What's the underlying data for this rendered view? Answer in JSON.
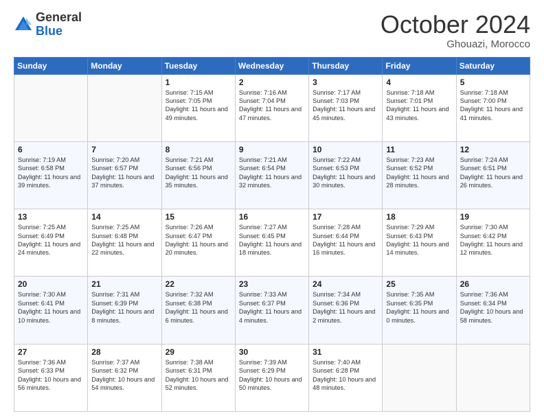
{
  "header": {
    "logo": {
      "general": "General",
      "blue": "Blue"
    },
    "title": "October 2024",
    "location": "Ghouazi, Morocco"
  },
  "days_of_week": [
    "Sunday",
    "Monday",
    "Tuesday",
    "Wednesday",
    "Thursday",
    "Friday",
    "Saturday"
  ],
  "weeks": [
    [
      {
        "day": "",
        "text": ""
      },
      {
        "day": "",
        "text": ""
      },
      {
        "day": "1",
        "text": "Sunrise: 7:15 AM\nSunset: 7:05 PM\nDaylight: 11 hours and 49 minutes."
      },
      {
        "day": "2",
        "text": "Sunrise: 7:16 AM\nSunset: 7:04 PM\nDaylight: 11 hours and 47 minutes."
      },
      {
        "day": "3",
        "text": "Sunrise: 7:17 AM\nSunset: 7:03 PM\nDaylight: 11 hours and 45 minutes."
      },
      {
        "day": "4",
        "text": "Sunrise: 7:18 AM\nSunset: 7:01 PM\nDaylight: 11 hours and 43 minutes."
      },
      {
        "day": "5",
        "text": "Sunrise: 7:18 AM\nSunset: 7:00 PM\nDaylight: 11 hours and 41 minutes."
      }
    ],
    [
      {
        "day": "6",
        "text": "Sunrise: 7:19 AM\nSunset: 6:58 PM\nDaylight: 11 hours and 39 minutes."
      },
      {
        "day": "7",
        "text": "Sunrise: 7:20 AM\nSunset: 6:57 PM\nDaylight: 11 hours and 37 minutes."
      },
      {
        "day": "8",
        "text": "Sunrise: 7:21 AM\nSunset: 6:56 PM\nDaylight: 11 hours and 35 minutes."
      },
      {
        "day": "9",
        "text": "Sunrise: 7:21 AM\nSunset: 6:54 PM\nDaylight: 11 hours and 32 minutes."
      },
      {
        "day": "10",
        "text": "Sunrise: 7:22 AM\nSunset: 6:53 PM\nDaylight: 11 hours and 30 minutes."
      },
      {
        "day": "11",
        "text": "Sunrise: 7:23 AM\nSunset: 6:52 PM\nDaylight: 11 hours and 28 minutes."
      },
      {
        "day": "12",
        "text": "Sunrise: 7:24 AM\nSunset: 6:51 PM\nDaylight: 11 hours and 26 minutes."
      }
    ],
    [
      {
        "day": "13",
        "text": "Sunrise: 7:25 AM\nSunset: 6:49 PM\nDaylight: 11 hours and 24 minutes."
      },
      {
        "day": "14",
        "text": "Sunrise: 7:25 AM\nSunset: 6:48 PM\nDaylight: 11 hours and 22 minutes."
      },
      {
        "day": "15",
        "text": "Sunrise: 7:26 AM\nSunset: 6:47 PM\nDaylight: 11 hours and 20 minutes."
      },
      {
        "day": "16",
        "text": "Sunrise: 7:27 AM\nSunset: 6:45 PM\nDaylight: 11 hours and 18 minutes."
      },
      {
        "day": "17",
        "text": "Sunrise: 7:28 AM\nSunset: 6:44 PM\nDaylight: 11 hours and 16 minutes."
      },
      {
        "day": "18",
        "text": "Sunrise: 7:29 AM\nSunset: 6:43 PM\nDaylight: 11 hours and 14 minutes."
      },
      {
        "day": "19",
        "text": "Sunrise: 7:30 AM\nSunset: 6:42 PM\nDaylight: 11 hours and 12 minutes."
      }
    ],
    [
      {
        "day": "20",
        "text": "Sunrise: 7:30 AM\nSunset: 6:41 PM\nDaylight: 11 hours and 10 minutes."
      },
      {
        "day": "21",
        "text": "Sunrise: 7:31 AM\nSunset: 6:39 PM\nDaylight: 11 hours and 8 minutes."
      },
      {
        "day": "22",
        "text": "Sunrise: 7:32 AM\nSunset: 6:38 PM\nDaylight: 11 hours and 6 minutes."
      },
      {
        "day": "23",
        "text": "Sunrise: 7:33 AM\nSunset: 6:37 PM\nDaylight: 11 hours and 4 minutes."
      },
      {
        "day": "24",
        "text": "Sunrise: 7:34 AM\nSunset: 6:36 PM\nDaylight: 11 hours and 2 minutes."
      },
      {
        "day": "25",
        "text": "Sunrise: 7:35 AM\nSunset: 6:35 PM\nDaylight: 11 hours and 0 minutes."
      },
      {
        "day": "26",
        "text": "Sunrise: 7:36 AM\nSunset: 6:34 PM\nDaylight: 10 hours and 58 minutes."
      }
    ],
    [
      {
        "day": "27",
        "text": "Sunrise: 7:36 AM\nSunset: 6:33 PM\nDaylight: 10 hours and 56 minutes."
      },
      {
        "day": "28",
        "text": "Sunrise: 7:37 AM\nSunset: 6:32 PM\nDaylight: 10 hours and 54 minutes."
      },
      {
        "day": "29",
        "text": "Sunrise: 7:38 AM\nSunset: 6:31 PM\nDaylight: 10 hours and 52 minutes."
      },
      {
        "day": "30",
        "text": "Sunrise: 7:39 AM\nSunset: 6:29 PM\nDaylight: 10 hours and 50 minutes."
      },
      {
        "day": "31",
        "text": "Sunrise: 7:40 AM\nSunset: 6:28 PM\nDaylight: 10 hours and 48 minutes."
      },
      {
        "day": "",
        "text": ""
      },
      {
        "day": "",
        "text": ""
      }
    ]
  ]
}
